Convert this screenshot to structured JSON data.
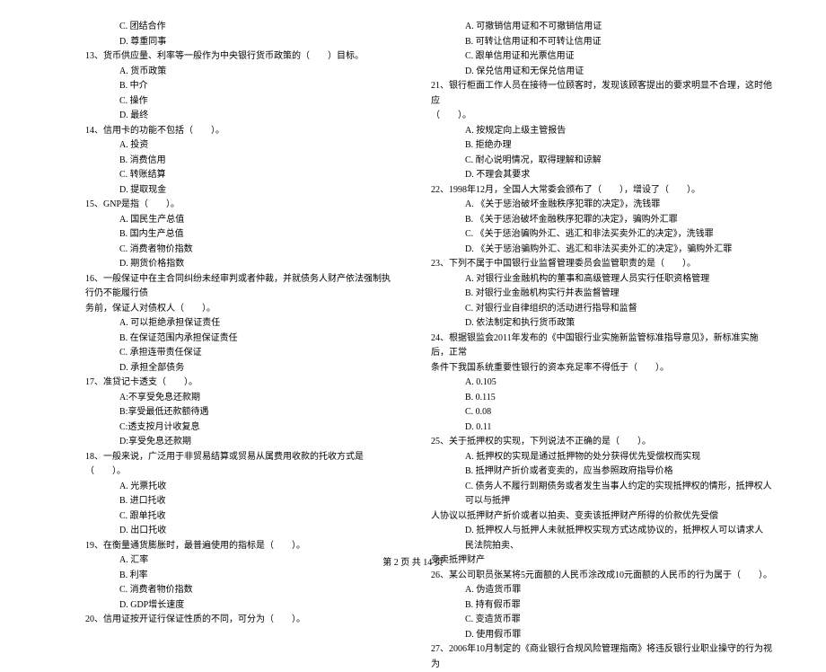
{
  "left": {
    "q12_c": "C. 团结合作",
    "q12_d": "D. 尊重同事",
    "q13": "13、货币供应量、利率等一般作为中央银行货币政策的（　　）目标。",
    "q13_a": "A. 货币政策",
    "q13_b": "B. 中介",
    "q13_c": "C. 操作",
    "q13_d": "D. 最终",
    "q14": "14、信用卡的功能不包括（　　）。",
    "q14_a": "A. 投资",
    "q14_b": "B. 消费信用",
    "q14_c": "C. 转账结算",
    "q14_d": "D. 提取现金",
    "q15": "15、GNP是指（　　）。",
    "q15_a": "A. 国民生产总值",
    "q15_b": "B. 国内生产总值",
    "q15_c": "C. 消费者物价指数",
    "q15_d": "D. 期货价格指数",
    "q16": "16、一般保证中在主合同纠纷未经审判或者仲裁，并就债务人财产依法强制执行仍不能履行债",
    "q16_cont": "务前，保证人对债权人（　　）。",
    "q16_a": "A. 可以拒绝承担保证责任",
    "q16_b": "B. 在保证范围内承担保证责任",
    "q16_c": "C. 承担连带责任保证",
    "q16_d": "D. 承担全部债务",
    "q17": "17、准贷记卡透支（　　）。",
    "q17_a": "A:不享受免息还款期",
    "q17_b": "B:享受最低还款额待遇",
    "q17_c": "C:透支按月计收复息",
    "q17_d": "D:享受免息还款期",
    "q18": "18、一般来说，广泛用于非贸易结算或贸易从属费用收款的托收方式是（　　）。",
    "q18_a": "A. 光票托收",
    "q18_b": "B. 进口托收",
    "q18_c": "C. 跟单托收",
    "q18_d": "D. 出口托收",
    "q19": "19、在衡量通货膨胀时，最普遍使用的指标是（　　）。",
    "q19_a": "A. 汇率",
    "q19_b": "B. 利率",
    "q19_c": "C. 消费者物价指数",
    "q19_d": "D. GDP增长速度",
    "q20": "20、信用证按开证行保证性质的不同，可分为（　　）。"
  },
  "right": {
    "q20_a": "A. 可撤销信用证和不可撤销信用证",
    "q20_b": "B. 可转让信用证和不可转让信用证",
    "q20_c": "C. 跟单信用证和光票信用证",
    "q20_d": "D. 保兑信用证和无保兑信用证",
    "q21": "21、银行柜面工作人员在接待一位顾客时，发现该顾客提出的要求明显不合理，这时他应",
    "q21_cont": "（　　）。",
    "q21_a": "A. 按规定向上级主管报告",
    "q21_b": "B. 拒绝办理",
    "q21_c": "C. 耐心说明情况，取得理解和谅解",
    "q21_d": "D. 不理会其要求",
    "q22": "22、1998年12月，全国人大常委会颁布了（　　），增设了（　　）。",
    "q22_a": "A. 《关于惩治破坏金融秩序犯罪的决定》，洗钱罪",
    "q22_b": "B. 《关于惩治破坏金融秩序犯罪的决定》，骗购外汇罪",
    "q22_c": "C. 《关于惩治骗购外汇、逃汇和非法买卖外汇的决定》，洗钱罪",
    "q22_d": "D. 《关于惩治骗购外汇、逃汇和非法买卖外汇的决定》，骗购外汇罪",
    "q23": "23、下列不属于中国银行业监督管理委员会监管职责的是（　　）。",
    "q23_a": "A. 对银行业金融机构的董事和高级管理人员实行任职资格管理",
    "q23_b": "B. 对银行业金融机构实行并表监督管理",
    "q23_c": "C. 对银行业自律组织的活动进行指导和监督",
    "q23_d": "D. 依法制定和执行货币政策",
    "q24": "24、根据银监会2011年发布的《中国银行业实施新监管标准指导意见》，新标准实施后，正常",
    "q24_cont": "条件下我国系统重要性银行的资本充足率不得低于（　　）。",
    "q24_a": "A. 0.105",
    "q24_b": "B. 0.115",
    "q24_c": "C. 0.08",
    "q24_d": "D. 0.11",
    "q25": "25、关于抵押权的实现，下列说法不正确的是（　　）。",
    "q25_a": "A. 抵押权的实现是通过抵押物的处分获得优先受偿权而实现",
    "q25_b": "B. 抵押财产折价或者变卖的，应当参照政府指导价格",
    "q25_c": "C. 债务人不履行到期债务或者发生当事人约定的实现抵押权的情形，抵押权人可以与抵押",
    "q25_c_cont": "人协议以抵押财产折价或者以拍卖、变卖该抵押财产所得的价款优先受偿",
    "q25_d": "D. 抵押权人与抵押人未就抵押权实现方式达成协议的，抵押权人可以请求人民法院拍卖、",
    "q25_d_cont": "变卖抵押财产",
    "q26": "26、某公司职员张某将5元面额的人民币涂改成10元面额的人民币的行为属于（　　）。",
    "q26_a": "A. 伪造货币罪",
    "q26_b": "B. 持有假币罪",
    "q26_c": "C. 变造货币罪",
    "q26_d": "D. 使用假币罪",
    "q27": "27、2006年10月制定的《商业银行合规风险管理指南》将违反银行业职业操守的行为视为"
  },
  "footer": "第 2 页 共 14 页"
}
